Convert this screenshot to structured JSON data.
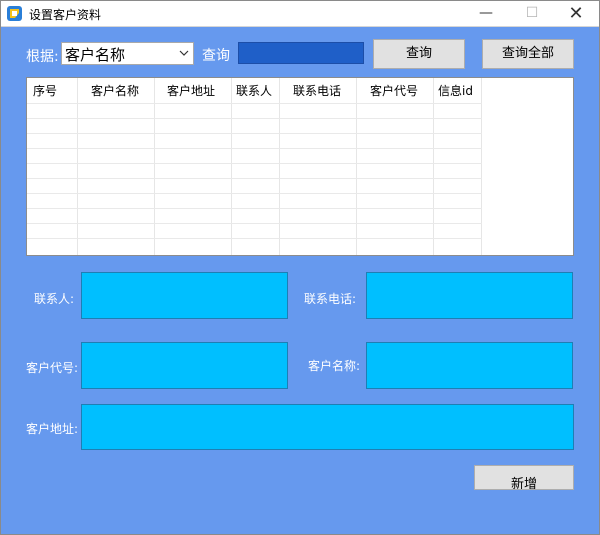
{
  "window": {
    "title": "设置客户资料",
    "minimize": "—",
    "maximize": "☐",
    "close": "✕"
  },
  "search": {
    "by_label": "根据:",
    "field_value": "客户名称",
    "query_label": "查询",
    "query_value": ""
  },
  "buttons": {
    "query": "查询",
    "query_all": "查询全部",
    "add": "新增"
  },
  "table": {
    "columns": [
      "序号",
      "客户名称",
      "客户地址",
      "联系人",
      "联系电话",
      "客户代号",
      "信息id"
    ],
    "rows": []
  },
  "form": {
    "contact_label": "联系人:",
    "phone_label": "联系电话:",
    "code_label": "客户代号:",
    "name_label": "客户名称:",
    "address_label": "客户地址:",
    "contact": "",
    "phone": "",
    "code": "",
    "name": "",
    "address": ""
  },
  "colors": {
    "window_bg": "#6699ee",
    "field_bg": "#00bfff",
    "query_input_bg": "#1f5fc8"
  }
}
